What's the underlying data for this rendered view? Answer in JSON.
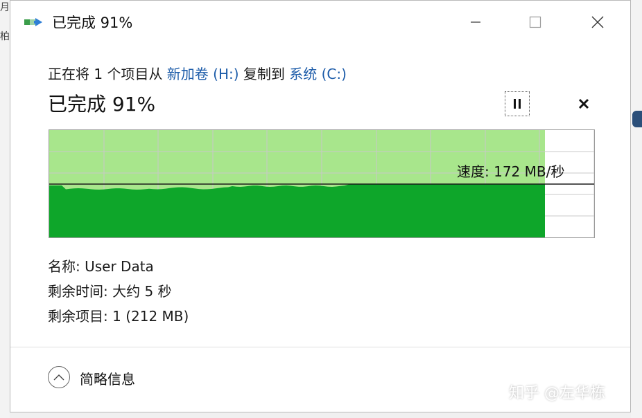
{
  "background": {
    "left_glyph_1": "月",
    "left_glyph_2": "柏"
  },
  "titlebar": {
    "title": "已完成 91%",
    "icon": "file-copy-icon",
    "minimize_icon": "minimize-icon",
    "maximize_icon": "maximize-icon",
    "close_icon": "close-icon"
  },
  "copy": {
    "prefix": "正在将 1 个项目从 ",
    "source": "新加卷 (H:)",
    "middle": " 复制到 ",
    "destination": "系统 (C:)"
  },
  "status": {
    "text": "已完成 91%",
    "percent": 91,
    "pause_icon": "pause-icon",
    "cancel_icon": "close-icon"
  },
  "graph": {
    "speed_text": "速度: 172 MB/秒",
    "progress_fraction": 0.91,
    "colors": {
      "done_light": "#a8e68c",
      "throughput": "#0ea62a",
      "grid": "#c8c8c8"
    }
  },
  "details": {
    "name_label": "名称: ",
    "name_value": "User Data",
    "time_label": "剩余时间: ",
    "time_value": "大约 5 秒",
    "items_label": "剩余项目: ",
    "items_value": "1 (212 MB)"
  },
  "footer": {
    "toggle_label": "简略信息",
    "toggle_icon": "chevron-up-icon"
  },
  "watermark": "知乎 @左华栋"
}
